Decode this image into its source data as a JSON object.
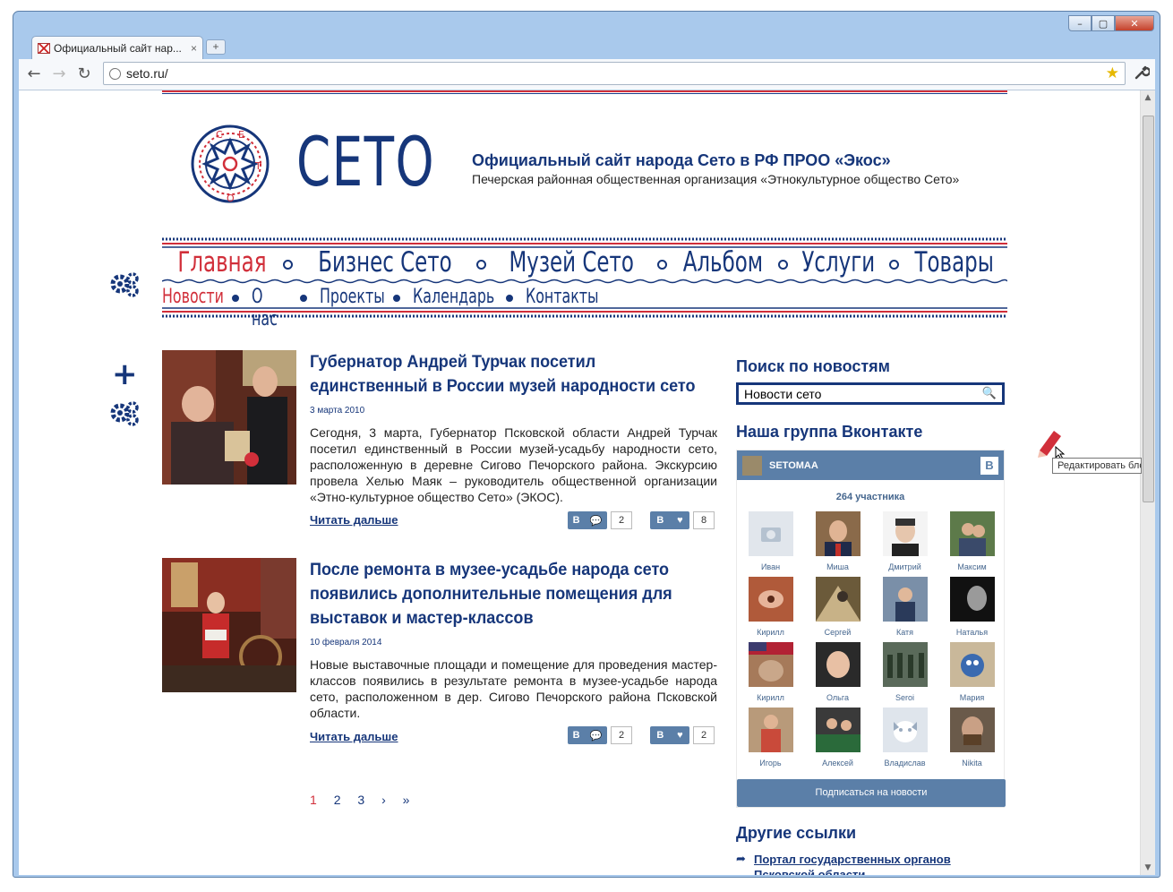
{
  "browser": {
    "tab_title": "Официальный сайт нар...",
    "tab_close": "×",
    "new_tab": "+",
    "url": "seto.ru/",
    "back": "←",
    "forward": "→",
    "reload": "↻",
    "star": "★",
    "wrench": "🔧",
    "win_min": "–",
    "win_max": "▢",
    "win_close": "✕"
  },
  "header": {
    "logo_text": "СЕТО",
    "title": "Официальный сайт народа Сето в РФ ПРОО «Экос»",
    "subtitle": "Печерская районная общественная организация «Этнокультурное общество Сето»"
  },
  "main_menu": [
    "Главная",
    "Бизнес Сето",
    "Музей Сето",
    "Альбом",
    "Услуги",
    "Товары"
  ],
  "sub_menu": [
    "Новости",
    "О нас",
    "Проекты",
    "Календарь",
    "Контакты"
  ],
  "news": [
    {
      "title": "Губернатор Андрей Турчак посетил единственный в России музей народности сето",
      "date": "3 марта 2010",
      "text": "Сегодня, 3 марта, Губернатор Псковской области Андрей Турчак посетил единственный в России музей-усадьбу народности сето, расположенную в деревне Сигово Печорского района. Экскурсию провела Хелью Маяк – руководитель общественной организации «Этно-культурное общество Сето» (ЭКОС).",
      "read_more": "Читать дальше",
      "share_count": "2",
      "like_count": "8"
    },
    {
      "title": "После ремонта в музее-усадьбе народа сето появились дополнительные помещения для выставок и мастер-классов",
      "date": "10 февраля 2014",
      "text": "Новые выставочные площади и помещение для проведения мастер-классов появились в результате ремонта в музее-усадьбе народа сето, расположенном в дер. Сигово Печорского района Псковской области.",
      "read_more": "Читать дальше",
      "share_count": "2",
      "like_count": "2"
    }
  ],
  "vk_btn_letter": "В",
  "pager": [
    "1",
    "2",
    "3",
    "›",
    "»"
  ],
  "sidebar": {
    "search_title": "Поиск по новостям",
    "search_value": "Новости сето",
    "vk_title": "Наша группа Вконтакте",
    "vk_group": "SETOMAA",
    "vk_count": "264 участника",
    "members": [
      "Иван",
      "Миша",
      "Дмитрий",
      "Максим",
      "Кирилл",
      "Сергей",
      "Катя",
      "Наталья",
      "Кирилл",
      "Ольга",
      "Seroi",
      "Мария",
      "Игорь",
      "Алексей",
      "Владислав",
      "Nikita"
    ],
    "subscribe": "Подписаться на новости",
    "links_title": "Другие ссылки",
    "links": [
      "Портал государственных органов Псковской области"
    ]
  },
  "edit_tooltip": "Редактировать бло",
  "colors": {
    "brand": "#16367a",
    "accent": "#d12f3a",
    "vk": "#5b7fa8"
  }
}
